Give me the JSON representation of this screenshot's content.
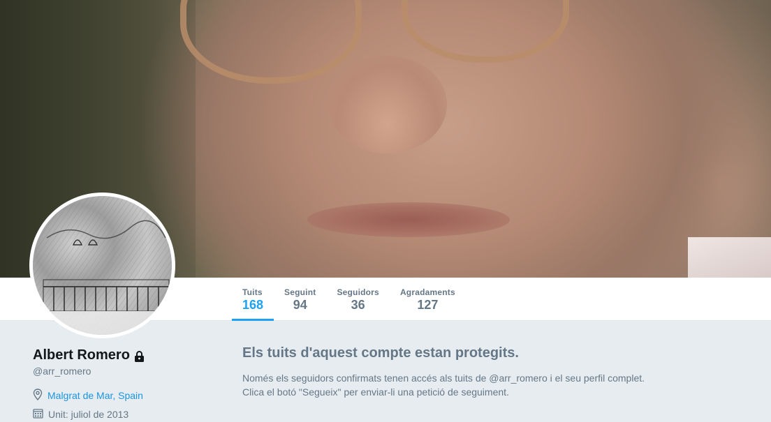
{
  "profile": {
    "name": "Albert Romero",
    "handle": "@arr_romero",
    "location": "Malgrat de Mar, Spain",
    "joined": "Unit: juliol de 2013"
  },
  "stats": [
    {
      "label": "Tuits",
      "value": "168",
      "active": true
    },
    {
      "label": "Seguint",
      "value": "94"
    },
    {
      "label": "Seguidors",
      "value": "36"
    },
    {
      "label": "Agradaments",
      "value": "127"
    }
  ],
  "protected": {
    "title": "Els tuits d'aquest compte estan protegits.",
    "line1": "Només els seguidors confirmats tenen accés als tuits de @arr_romero i el seu perfil complet.",
    "line2": "Clica el botó \"Segueix\" per enviar-li una petició de seguiment."
  },
  "colors": {
    "accent": "#1da1f2",
    "link": "#1b95e0",
    "muted": "#657786",
    "background": "#e6ecf0"
  },
  "icons": {
    "lock": "lock-icon",
    "location": "location-pin-icon",
    "calendar": "calendar-icon"
  }
}
